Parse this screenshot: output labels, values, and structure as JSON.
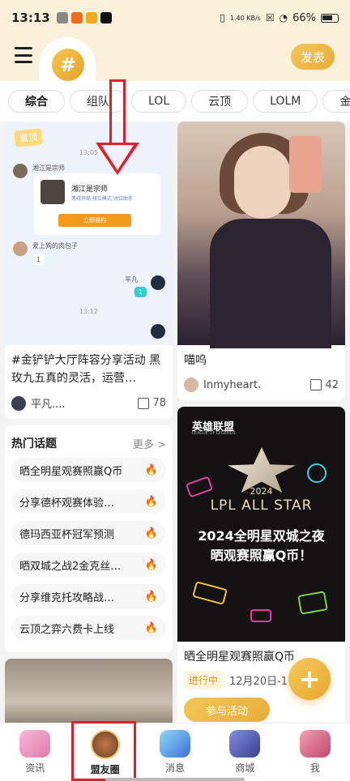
{
  "status_bar": {
    "time": "13:13",
    "net_speed": "1.40 KB/s",
    "battery": "66%"
  },
  "header": {
    "logo_symbol": "#",
    "post_label": "发表"
  },
  "tabs": [
    {
      "label": "综合",
      "active": true
    },
    {
      "label": "组队",
      "active": false
    },
    {
      "label": "LOL",
      "active": false
    },
    {
      "label": "云顶",
      "active": false
    },
    {
      "label": "LOLM",
      "active": false
    },
    {
      "label": "金",
      "active": false
    }
  ],
  "feed": {
    "post1": {
      "chat": {
        "pin_label": "置顶",
        "time1": "13:05",
        "sender1": "湘江是宗师",
        "card_name": "湘江是宗师",
        "card_tags": "等待开局   排位模式   对位助手",
        "card_button": "立即邀约",
        "sender2": "爱上狗的肉包子",
        "bubble1": "1",
        "sender3": "平凡",
        "bubble2": "1",
        "time2": "13:12"
      },
      "title": "#金铲铲大厅阵容分享活动 黑玫九五真的灵活，运营…",
      "user": "平凡....",
      "likes": "78"
    },
    "topics": {
      "title": "热门话题",
      "more": "更多 >",
      "items": [
        "晒全明星观赛照赢Q币",
        "分享德杯观赛体验…",
        "德玛西亚杯冠军预测",
        "晒双城之战2金克丝…",
        "分享维克托攻略战…",
        "云顶之弈六费卡上线"
      ]
    },
    "post2": {
      "title": "喵呜",
      "user": "Inmyheart.",
      "likes": "42"
    },
    "post3": {
      "poster": {
        "brand": "英雄联盟",
        "brand_sub": "LEAGUE OF LEGENDS",
        "year": "2024",
        "event": "LPL ALL STAR",
        "line1": "2024全明星双城之夜",
        "line2": "晒观赛照赢Q币！"
      },
      "title": "晒全明星观赛照赢Q币",
      "status": "进行中",
      "date": "12月20日-1",
      "button": "参与活动"
    }
  },
  "fab_symbol": "+",
  "bottom_nav": [
    {
      "label": "资讯",
      "active": false
    },
    {
      "label": "盟友圈",
      "active": true
    },
    {
      "label": "消息",
      "active": false
    },
    {
      "label": "商城",
      "active": false
    },
    {
      "label": "我",
      "active": false
    }
  ],
  "colors": {
    "accent": "#E9AE3B",
    "highlight": "#E0202A",
    "header_bg": "#FBF1DB"
  }
}
